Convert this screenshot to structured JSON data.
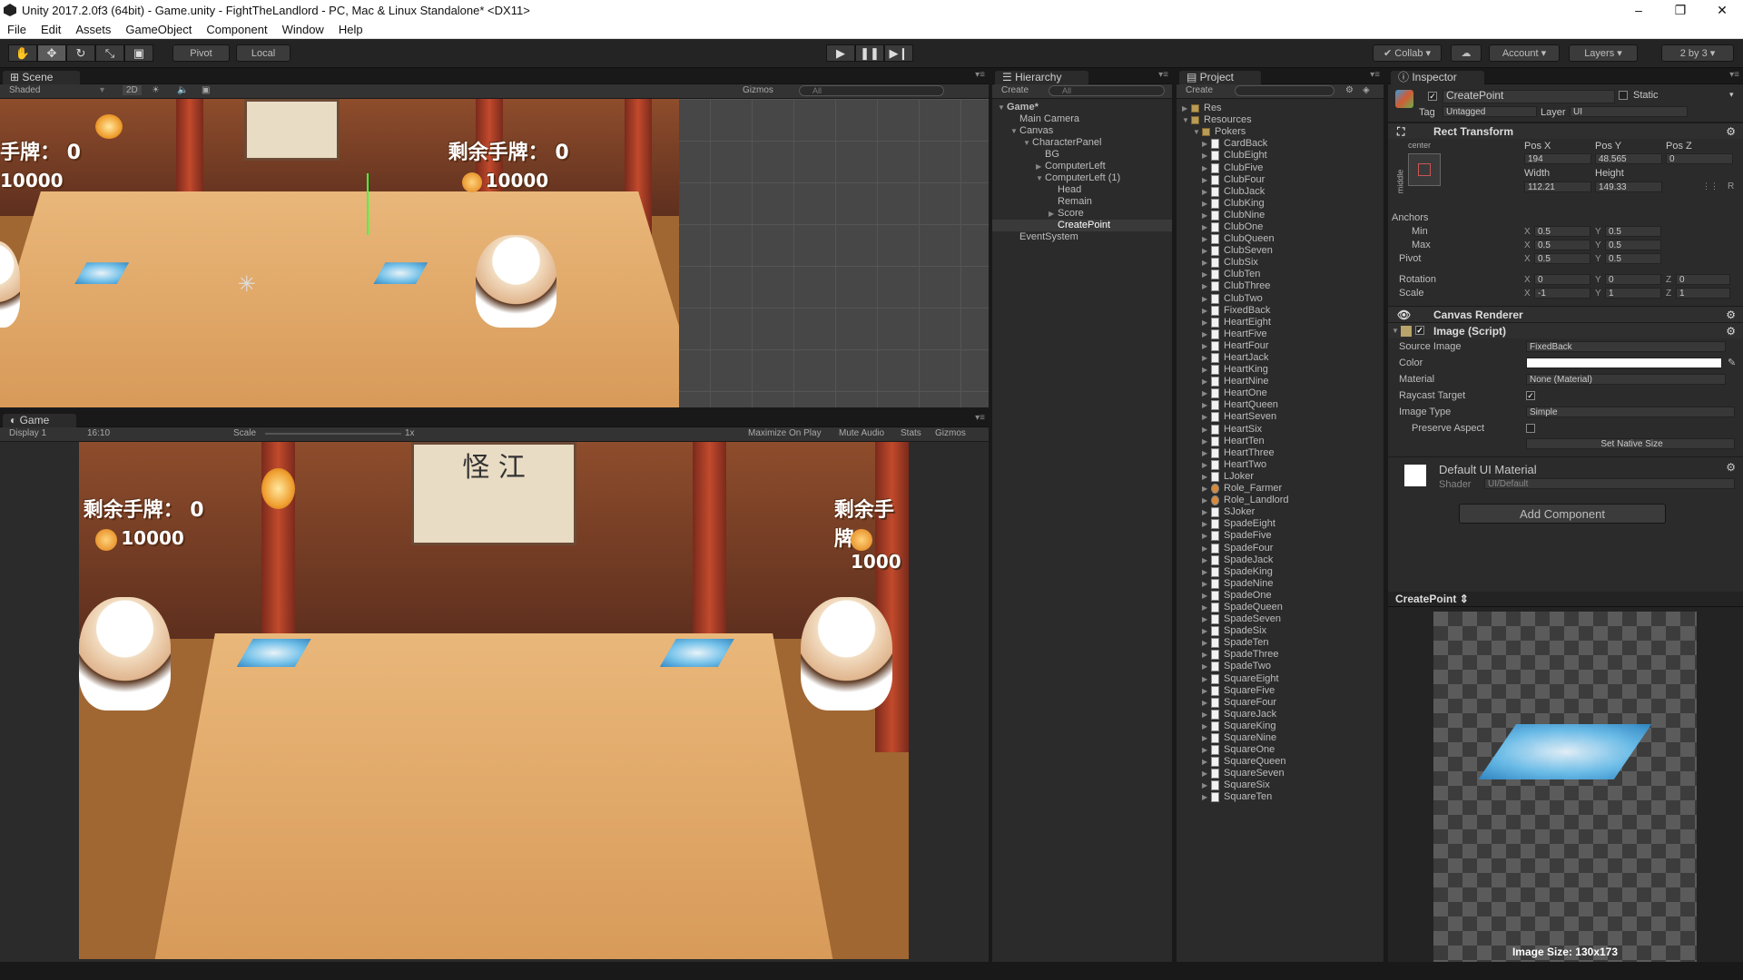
{
  "window": {
    "title": "Unity 2017.2.0f3 (64bit) - Game.unity - FightTheLandlord - PC, Mac & Linux Standalone* <DX11>"
  },
  "menu": [
    "File",
    "Edit",
    "Assets",
    "GameObject",
    "Component",
    "Window",
    "Help"
  ],
  "toolbar": {
    "pivot": "Pivot",
    "local": "Local",
    "collab": "Collab",
    "account": "Account",
    "layers": "Layers",
    "layout": "2 by 3"
  },
  "scene": {
    "tab": "Scene",
    "shading": "Shaded",
    "mode_2d": "2D",
    "gizmos": "Gizmos",
    "search": "All",
    "hud_left_label": "手牌： 0",
    "hud_left_coins": "10000",
    "hud_right_label": "剩余手牌： 0",
    "hud_right_coins": "10000"
  },
  "game": {
    "tab": "Game",
    "display": "Display 1",
    "aspect": "16:10",
    "scale_label": "Scale",
    "scale_value": "1x",
    "max_on_play": "Maximize On Play",
    "mute": "Mute Audio",
    "stats": "Stats",
    "gizmos": "Gizmos",
    "hud_left_label": "剩余手牌： 0",
    "hud_left_coins": "10000",
    "hud_right_label": "剩余手牌",
    "hud_right_coins": "1000",
    "scroll_text": "怪 江"
  },
  "hierarchy": {
    "tab": "Hierarchy",
    "create": "Create",
    "search": "All",
    "items": [
      {
        "label": "Game*",
        "indent": 0,
        "arrow": "▼",
        "bold": true
      },
      {
        "label": "Main Camera",
        "indent": 1,
        "arrow": ""
      },
      {
        "label": "Canvas",
        "indent": 1,
        "arrow": "▼"
      },
      {
        "label": "CharacterPanel",
        "indent": 2,
        "arrow": "▼"
      },
      {
        "label": "BG",
        "indent": 3,
        "arrow": ""
      },
      {
        "label": "ComputerLeft",
        "indent": 3,
        "arrow": "▶"
      },
      {
        "label": "ComputerLeft (1)",
        "indent": 3,
        "arrow": "▼"
      },
      {
        "label": "Head",
        "indent": 4,
        "arrow": ""
      },
      {
        "label": "Remain",
        "indent": 4,
        "arrow": ""
      },
      {
        "label": "Score",
        "indent": 4,
        "arrow": "▶"
      },
      {
        "label": "CreatePoint",
        "indent": 4,
        "arrow": "",
        "selected": true
      },
      {
        "label": "EventSystem",
        "indent": 1,
        "arrow": ""
      }
    ]
  },
  "project": {
    "tab": "Project",
    "create": "Create",
    "folders": [
      {
        "label": "Res",
        "indent": 0
      },
      {
        "label": "Resources",
        "indent": 0
      },
      {
        "label": "Pokers",
        "indent": 1
      }
    ],
    "assets": [
      "CardBack",
      "ClubEight",
      "ClubFive",
      "ClubFour",
      "ClubJack",
      "ClubKing",
      "ClubNine",
      "ClubOne",
      "ClubQueen",
      "ClubSeven",
      "ClubSix",
      "ClubTen",
      "ClubThree",
      "ClubTwo",
      "FixedBack",
      "HeartEight",
      "HeartFive",
      "HeartFour",
      "HeartJack",
      "HeartKing",
      "HeartNine",
      "HeartOne",
      "HeartQueen",
      "HeartSeven",
      "HeartSix",
      "HeartTen",
      "HeartThree",
      "HeartTwo",
      "LJoker",
      "Role_Farmer",
      "Role_Landlord",
      "SJoker",
      "SpadeEight",
      "SpadeFive",
      "SpadeFour",
      "SpadeJack",
      "SpadeKing",
      "SpadeNine",
      "SpadeOne",
      "SpadeQueen",
      "SpadeSeven",
      "SpadeSix",
      "SpadeTen",
      "SpadeThree",
      "SpadeTwo",
      "SquareEight",
      "SquareFive",
      "SquareFour",
      "SquareJack",
      "SquareKing",
      "SquareNine",
      "SquareOne",
      "SquareQueen",
      "SquareSeven",
      "SquareSix",
      "SquareTen"
    ]
  },
  "inspector": {
    "tab": "Inspector",
    "object_name": "CreatePoint",
    "static": "Static",
    "tag_label": "Tag",
    "tag": "Untagged",
    "layer_label": "Layer",
    "layer": "UI",
    "rect_transform": {
      "title": "Rect Transform",
      "anchor_h": "center",
      "anchor_v": "middle",
      "posx_label": "Pos X",
      "posy_label": "Pos Y",
      "posz_label": "Pos Z",
      "posx": "194",
      "posy": "48.565",
      "posz": "0",
      "width_label": "Width",
      "height_label": "Height",
      "width": "112.21",
      "height": "149.33",
      "r_button": "R",
      "anchors": "Anchors",
      "min": "Min",
      "max": "Max",
      "pivot": "Pivot",
      "x": "X",
      "y": "Y",
      "z": "Z",
      "min_x": "0.5",
      "min_y": "0.5",
      "max_x": "0.5",
      "max_y": "0.5",
      "pivot_x": "0.5",
      "pivot_y": "0.5",
      "rotation": "Rotation",
      "rot_x": "0",
      "rot_y": "0",
      "rot_z": "0",
      "scale": "Scale",
      "scale_x": "-1",
      "scale_y": "1",
      "scale_z": "1"
    },
    "canvas_renderer": "Canvas Renderer",
    "image": {
      "title": "Image (Script)",
      "source_label": "Source Image",
      "source": "FixedBack",
      "color_label": "Color",
      "material_label": "Material",
      "material": "None (Material)",
      "raycast_label": "Raycast Target",
      "type_label": "Image Type",
      "type": "Simple",
      "preserve_label": "Preserve Aspect",
      "native_size": "Set Native Size"
    },
    "material": {
      "name": "Default UI Material",
      "shader_label": "Shader",
      "shader": "UI/Default"
    },
    "add_component": "Add Component",
    "preview_title": "CreatePoint",
    "image_size": "Image Size: 130x173"
  },
  "colors": {
    "accent": "#3a72b0",
    "panel": "#2b2b2b",
    "dark": "#191919"
  }
}
